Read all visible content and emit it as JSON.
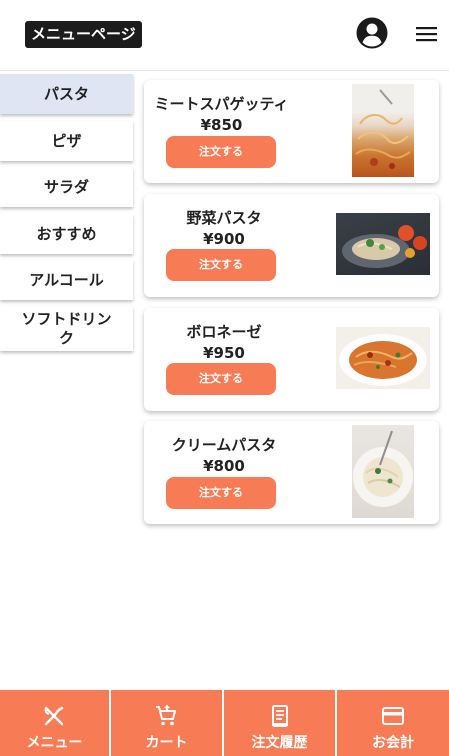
{
  "header": {
    "title": "メニューページ",
    "account_icon": "account-circle-icon",
    "menu_icon": "hamburger-menu-icon"
  },
  "categories": [
    {
      "label": "パスタ",
      "active": true
    },
    {
      "label": "ピザ",
      "active": false
    },
    {
      "label": "サラダ",
      "active": false
    },
    {
      "label": "おすすめ",
      "active": false
    },
    {
      "label": "アルコール",
      "active": false
    },
    {
      "label": "ソフトドリンク",
      "active": false
    }
  ],
  "menu_items": [
    {
      "name": "ミートスパゲッティ",
      "price": "¥850",
      "order_label": "注文する",
      "image": "meat-spaghetti-photo"
    },
    {
      "name": "野菜パスタ",
      "price": "¥900",
      "order_label": "注文する",
      "image": "vegetable-pasta-photo"
    },
    {
      "name": "ボロネーゼ",
      "price": "¥950",
      "order_label": "注文する",
      "image": "bolognese-photo"
    },
    {
      "name": "クリームパスタ",
      "price": "¥800",
      "order_label": "注文する",
      "image": "cream-pasta-photo"
    }
  ],
  "bottom_nav": [
    {
      "label": "メニュー",
      "icon": "fork-knife-icon"
    },
    {
      "label": "カート",
      "icon": "cart-add-icon"
    },
    {
      "label": "注文履歴",
      "icon": "receipt-icon"
    },
    {
      "label": "お会計",
      "icon": "credit-card-icon"
    }
  ],
  "colors": {
    "accent": "#f77b54",
    "active_category": "#dfe5f2",
    "title_bg": "#1c1c1c"
  }
}
